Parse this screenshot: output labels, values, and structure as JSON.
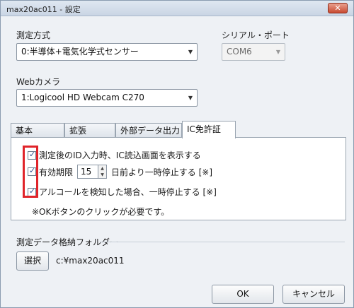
{
  "window": {
    "title": "max20ac011 - 設定",
    "close_glyph": "✕"
  },
  "measurement": {
    "label": "測定方式",
    "selected": "0:半導体+電気化学式センサー"
  },
  "serial": {
    "label": "シリアル・ポート",
    "selected": "COM6",
    "disabled": true
  },
  "camera": {
    "label": "Webカメラ",
    "selected": "1:Logicool HD Webcam C270"
  },
  "tabs": [
    {
      "label": "基本",
      "active": false
    },
    {
      "label": "拡張",
      "active": false
    },
    {
      "label": "外部データ出力",
      "active": false
    },
    {
      "label": "IC免許証",
      "active": true
    }
  ],
  "ic_panel": {
    "opt1": {
      "label": "測定後のID入力時、IC読込画面を表示する",
      "checked": true
    },
    "opt2": {
      "label_prefix": "有効期限",
      "value": "15",
      "label_suffix": "日前より一時停止する [※]",
      "checked": true
    },
    "opt3": {
      "label": "アルコールを検知した場合、一時停止する [※]",
      "checked": true
    },
    "note": "※OKボタンのクリックが必要です。",
    "highlight_color": "#e0242a"
  },
  "folder": {
    "label": "測定データ格納フォルダー",
    "select_button": "選択",
    "path": "c:¥max20ac011"
  },
  "buttons": {
    "ok": "OK",
    "cancel": "キャンセル"
  },
  "icons": {
    "dropdown": "dropdown-arrow-icon",
    "check": "checkmark-icon",
    "spin_up": "spin-up-icon",
    "spin_down": "spin-down-icon"
  }
}
